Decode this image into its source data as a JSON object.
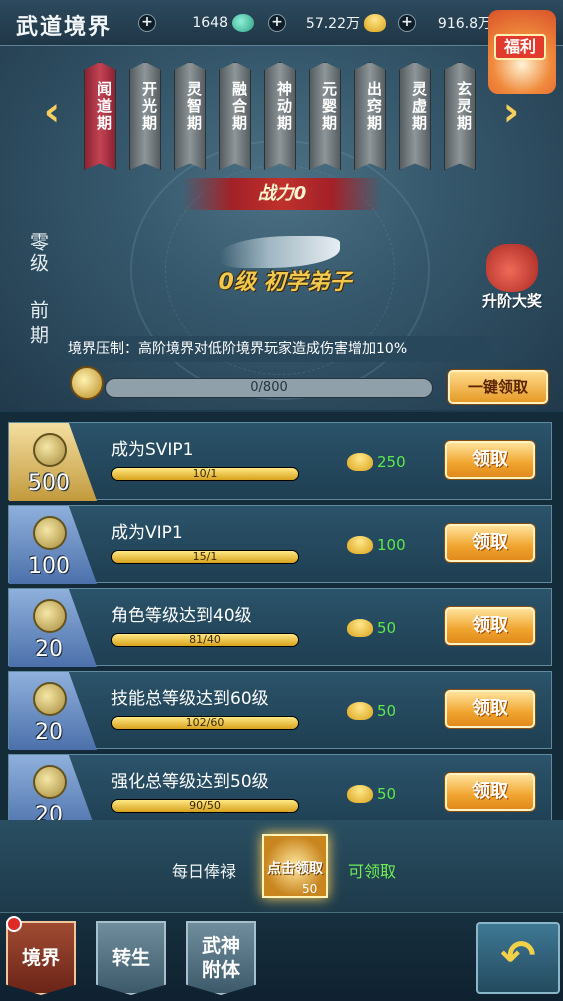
{
  "header": {
    "title": "武道境界",
    "resources": [
      {
        "value": "1648",
        "icon": "jade-gem-icon"
      },
      {
        "value": "57.22万",
        "icon": "gold-ingot-icon"
      },
      {
        "value": "916.8万",
        "icon": "silver-coin-icon"
      }
    ],
    "welfare_label": "福利"
  },
  "stages": [
    {
      "label": "闻道期",
      "active": true
    },
    {
      "label": "开光期",
      "active": false
    },
    {
      "label": "灵智期",
      "active": false
    },
    {
      "label": "融合期",
      "active": false
    },
    {
      "label": "神动期",
      "active": false
    },
    {
      "label": "元婴期",
      "active": false
    },
    {
      "label": "出窍期",
      "active": false
    },
    {
      "label": "灵虚期",
      "active": false
    },
    {
      "label": "玄灵期",
      "active": false
    }
  ],
  "realm": {
    "power": "战力0",
    "rank": "0级 初学弟子",
    "level": "零级",
    "phase": "前期",
    "reward_label": "升阶大奖",
    "suppress_text": "境界压制：高阶境界对低阶境界玩家造成伤害增加10%",
    "total_progress": "0/800",
    "total_fraction": 0,
    "onekey_label": "一键领取"
  },
  "tasks": [
    {
      "badge": "500",
      "name": "成为SVIP1",
      "progress": "10/1",
      "fraction": 1,
      "reward": "250",
      "button": "领取",
      "gold": true
    },
    {
      "badge": "100",
      "name": "成为VIP1",
      "progress": "15/1",
      "fraction": 1,
      "reward": "100",
      "button": "领取",
      "gold": false
    },
    {
      "badge": "20",
      "name": "角色等级达到40级",
      "progress": "81/40",
      "fraction": 1,
      "reward": "50",
      "button": "领取",
      "gold": false
    },
    {
      "badge": "20",
      "name": "技能总等级达到60级",
      "progress": "102/60",
      "fraction": 1,
      "reward": "50",
      "button": "领取",
      "gold": false
    },
    {
      "badge": "20",
      "name": "强化总等级达到50级",
      "progress": "90/50",
      "fraction": 1,
      "reward": "50",
      "button": "领取",
      "gold": false
    }
  ],
  "daily": {
    "label": "每日俸禄",
    "button": "点击领取",
    "amount": "50",
    "status": "可领取"
  },
  "nav": [
    {
      "label": "境界",
      "active": true
    },
    {
      "label": "转生",
      "active": false
    },
    {
      "label": "武神附体",
      "active": false
    }
  ],
  "colors": {
    "accent_gold": "#f2c94c",
    "status_green": "#6fef54",
    "active_tab": "#c44455"
  }
}
